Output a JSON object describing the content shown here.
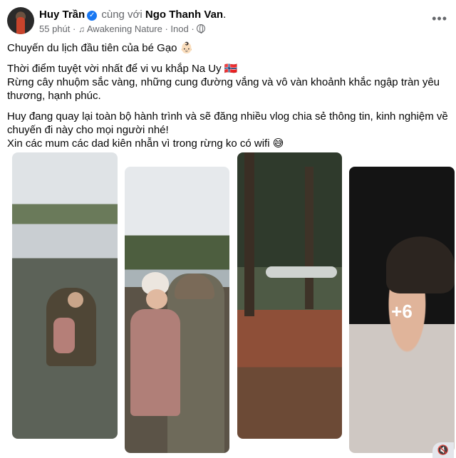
{
  "header": {
    "author": "Huy Trần",
    "with_text": "cùng với",
    "tagged": "Ngo Thanh Van",
    "time": "55 phút",
    "separator": "·",
    "music": "Awakening Nature · Inod",
    "verified_icon": "verified-badge",
    "audience_icon": "globe-icon",
    "more_icon": "more-options-icon"
  },
  "post": {
    "line1": "Chuyến du lịch đầu tiên của bé Gạo 👶🏻",
    "line2": "Thời điểm tuyệt vời nhất để vi vu khắp Na Uy 🇳🇴",
    "line3": "Rừng cây nhuộm sắc vàng, những cung đường vắng và vô vàn khoảnh khắc ngập tràn yêu thương, hạnh phúc.",
    "line4": "Huy đang quay lại toàn bộ hành trình và sẽ đăng nhiều vlog chia sẻ thông tin, kinh nghiệm về chuyến đi này cho mọi người nhé!",
    "line5": "Xin các mum các dad kiên nhẫn vì trong rừng ko có wifi 😅"
  },
  "photos": {
    "more_count": "+6"
  },
  "controls": {
    "mute_icon": "speaker-muted-icon"
  }
}
